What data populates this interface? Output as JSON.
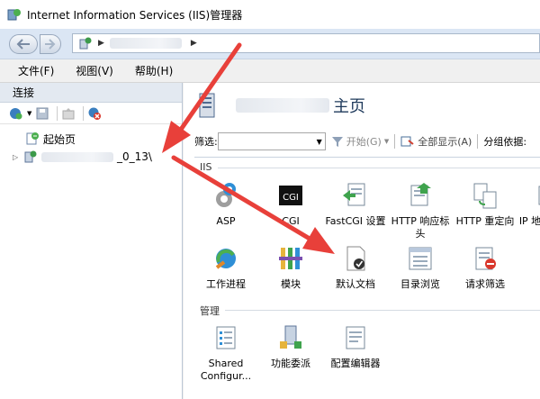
{
  "window": {
    "title": "Internet Information Services (IIS)管理器"
  },
  "address": {
    "segments": [
      "",
      ""
    ]
  },
  "menu": {
    "items": [
      "文件(F)",
      "视图(V)",
      "帮助(H)"
    ]
  },
  "connections": {
    "header": "连接",
    "tree": {
      "start_page": "起始页",
      "server": "_0_13\\"
    }
  },
  "main": {
    "title_suffix": "主页",
    "filter_label": "筛选:",
    "start_button": "开始(G)",
    "show_all_button": "全部显示(A)",
    "group_by_label": "分组依据:"
  },
  "groups": {
    "iis": {
      "title": "IIS",
      "features": [
        {
          "label": "ASP",
          "icon": "asp-icon"
        },
        {
          "label": "CGI",
          "icon": "cgi-icon"
        },
        {
          "label": "FastCGI 设置",
          "icon": "fastcgi-icon"
        },
        {
          "label": "HTTP 响应标头",
          "icon": "http-headers-icon"
        },
        {
          "label": "HTTP 重定向",
          "icon": "http-redirect-icon"
        },
        {
          "label": "IP 地址和域限制",
          "icon": "ip-restrictions-icon"
        },
        {
          "label": "工作进程",
          "icon": "worker-process-icon"
        },
        {
          "label": "模块",
          "icon": "modules-icon"
        },
        {
          "label": "默认文档",
          "icon": "default-document-icon"
        },
        {
          "label": "目录浏览",
          "icon": "directory-browsing-icon"
        },
        {
          "label": "请求筛选",
          "icon": "request-filtering-icon"
        },
        {
          "label": "",
          "icon": "partial-icon"
        }
      ]
    },
    "management": {
      "title": "管理",
      "features": [
        {
          "label": "Shared Configur...",
          "icon": "shared-config-icon"
        },
        {
          "label": "功能委派",
          "icon": "feature-delegation-icon"
        },
        {
          "label": "配置编辑器",
          "icon": "config-editor-icon"
        }
      ]
    }
  },
  "colors": {
    "annotation_arrow": "#e8403a",
    "header_text": "#1e395b"
  }
}
